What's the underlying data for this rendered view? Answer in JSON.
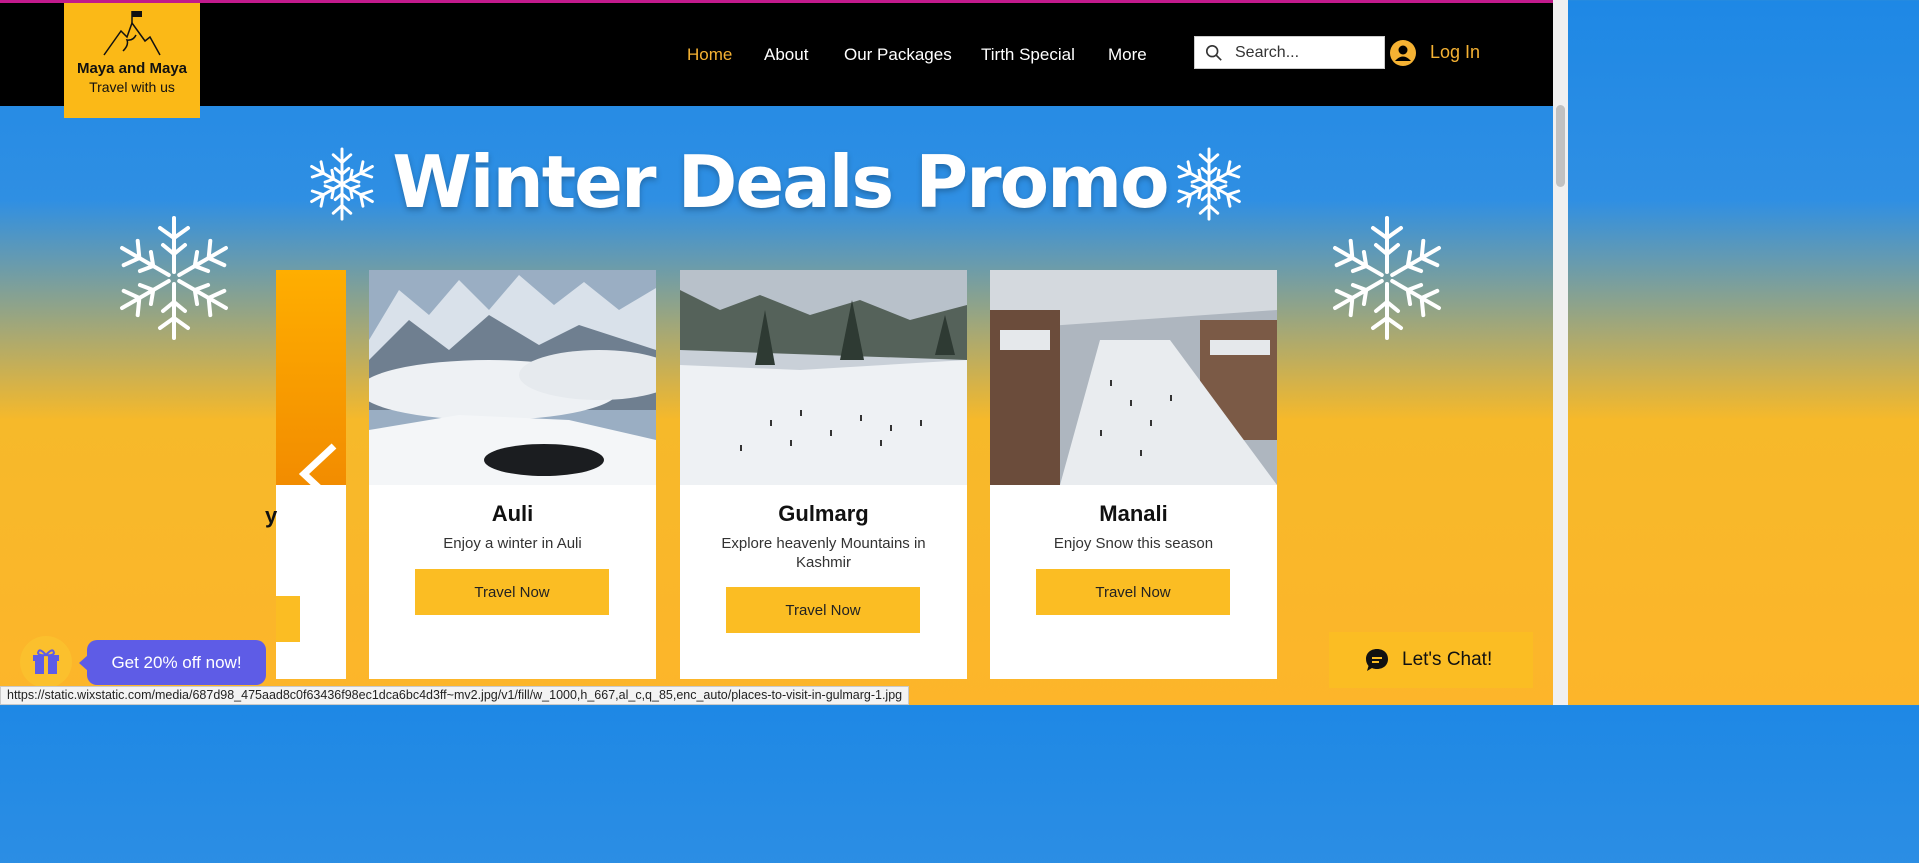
{
  "brand": {
    "name": "Maya and Maya",
    "tagline": "Travel with us"
  },
  "nav": [
    {
      "label": "Home",
      "active": true
    },
    {
      "label": "About"
    },
    {
      "label": "Our Packages"
    },
    {
      "label": "Tirth Special"
    },
    {
      "label": "More"
    }
  ],
  "search": {
    "placeholder": "Search..."
  },
  "login_label": "Log In",
  "promo": {
    "title": "Winter Deals Promo"
  },
  "partial_card": {
    "title_fragment": "y"
  },
  "cards": [
    {
      "title": "Auli",
      "description": "Enjoy a winter in Auli",
      "button": "Travel Now"
    },
    {
      "title": "Gulmarg",
      "description": "Explore heavenly Mountains in Kashmir",
      "button": "Travel Now"
    },
    {
      "title": "Manali",
      "description": "Enjoy Snow this season",
      "button": "Travel Now"
    }
  ],
  "offer": {
    "label": "Get 20% off now!"
  },
  "chat": {
    "label": "Let's Chat!"
  },
  "status_url": "https://static.wixstatic.com/media/687d98_475aad8c0f63436f98ec1dca6bc4d3ff~mv2.jpg/v1/fill/w_1000,h_667,al_c,q_85,enc_auto/places-to-visit-in-gulmarg-1.jpg",
  "colors": {
    "accent": "#fbbd23",
    "nav_active": "#f5b233",
    "offer": "#5e5ce6",
    "header": "#000000"
  }
}
